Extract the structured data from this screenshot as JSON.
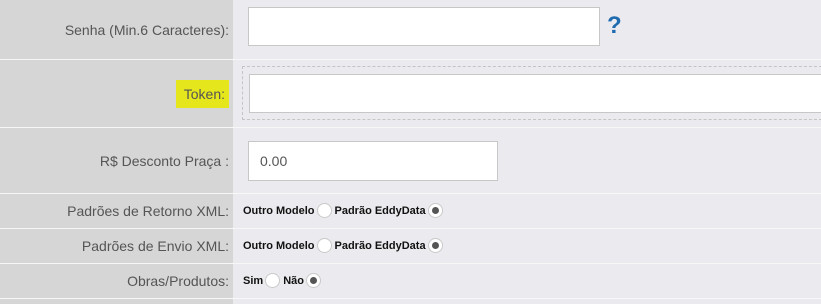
{
  "fields": {
    "senha": {
      "label": "Senha (Min.6 Caracteres):",
      "value": "",
      "help_icon": "question-mark-icon"
    },
    "token": {
      "label": "Token:",
      "value": "",
      "highlight_color": "#e6e61c"
    },
    "desconto": {
      "label": "R$ Desconto Praça :",
      "value": "0.00"
    },
    "retorno_xml": {
      "label": "Padrões de Retorno XML:",
      "options": [
        "Outro Modelo",
        "Padrão EddyData"
      ],
      "selected": "Padrão EddyData"
    },
    "envio_xml": {
      "label": "Padrões de Envio XML:",
      "options": [
        "Outro Modelo",
        "Padrão EddyData"
      ],
      "selected": "Padrão EddyData"
    },
    "obras": {
      "label": "Obras/Produtos:",
      "options": [
        "Sim",
        "Não"
      ],
      "selected": "Não"
    }
  },
  "colors": {
    "label_bg": "#d6d6d6",
    "value_bg": "#ebebef",
    "help_icon": "#1f6bb0"
  }
}
